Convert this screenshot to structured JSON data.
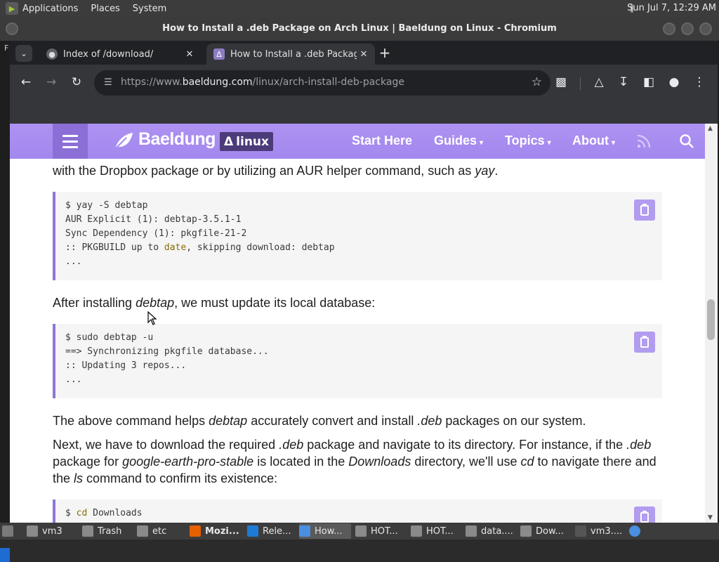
{
  "top_panel": {
    "menus": [
      "Applications",
      "Places",
      "System"
    ],
    "clock": "Sun Jul  7, 12:29 AM"
  },
  "window": {
    "title": "How to Install a .deb Package on Arch Linux | Baeldung on Linux - Chromium"
  },
  "desktop": {
    "left_label": "F"
  },
  "tabs": [
    {
      "title": "Index of /download/",
      "favicon": "globe-icon",
      "active": false
    },
    {
      "title": "How to Install a .deb Package",
      "favicon": "linux-penguin-icon",
      "active": true
    }
  ],
  "toolbar": {
    "url_scheme": "https://www.",
    "url_host": "baeldung.com",
    "url_path": "/linux/arch-install-deb-package"
  },
  "site_nav": {
    "logo": "Baeldung",
    "badge": "linux",
    "links": [
      {
        "label": "Start Here",
        "caret": false
      },
      {
        "label": "Guides",
        "caret": true
      },
      {
        "label": "Topics",
        "caret": true
      },
      {
        "label": "About",
        "caret": true
      }
    ]
  },
  "article": {
    "p0": {
      "a": "with the Dropbox package or by utilizing an AUR helper command, such as ",
      "b": "yay",
      "c": "."
    },
    "code1": [
      {
        "text": "$ yay -S debtap"
      },
      {
        "text": "AUR Explicit (1): debtap-3.5.1-1"
      },
      {
        "text": "Sync Dependency (1): pkgfile-21-2"
      },
      {
        "pre": ":: PKGBUILD up to ",
        "kw": "date",
        "post": ", skipping download: debtap"
      },
      {
        "text": "..."
      }
    ],
    "p1": {
      "a": "After installing ",
      "b": "debtap",
      "c": ", we must update its local database:"
    },
    "code2": [
      "$ sudo debtap -u",
      "==> Synchronizing pkgfile database...",
      ":: Updating 3 repos...",
      "..."
    ],
    "p2": {
      "a": "The above command helps ",
      "b": "debtap",
      "c": " accurately convert and install ",
      "d": ".deb",
      "e": " packages on our system."
    },
    "p3": {
      "a": "Next, we have to download the required ",
      "b": ".deb",
      "c": " package and navigate to its directory. For instance, if the ",
      "d": ".deb",
      "e": " package for ",
      "f": "google-earth-pro-stable",
      "g": " is located in the ",
      "h": "Downloads",
      "i": " directory, we'll use ",
      "j": "cd",
      "k": " to navigate there and the ",
      "l": "ls",
      "m": " command to confirm its existence:"
    },
    "code3": {
      "pre": "$ ",
      "kw": "cd",
      "post": " Downloads"
    }
  },
  "taskbar": [
    {
      "label": "vm3",
      "icon": "folder-icon",
      "color": "#8a8a8a"
    },
    {
      "label": "Trash",
      "icon": "trash-icon",
      "color": "#8a8a8a"
    },
    {
      "label": "etc",
      "icon": "folder-icon",
      "color": "#8a8a8a"
    },
    {
      "label": "Mozi...",
      "icon": "firefox-icon",
      "color": "#e66000",
      "bold": true
    },
    {
      "label": "Rele...",
      "icon": "vscode-icon",
      "color": "#1f7ad6"
    },
    {
      "label": "How...",
      "icon": "chromium-icon",
      "color": "#4a8fe0",
      "active": true
    },
    {
      "label": "HOT...",
      "icon": "text-editor-icon",
      "color": "#8a8a8a"
    },
    {
      "label": "HOT...",
      "icon": "text-editor-icon",
      "color": "#8a8a8a"
    },
    {
      "label": "data....",
      "icon": "text-editor-icon",
      "color": "#8a8a8a"
    },
    {
      "label": "Dow...",
      "icon": "folder-icon",
      "color": "#8a8a8a"
    },
    {
      "label": "vm3....",
      "icon": "terminal-icon",
      "color": "#555555"
    }
  ]
}
